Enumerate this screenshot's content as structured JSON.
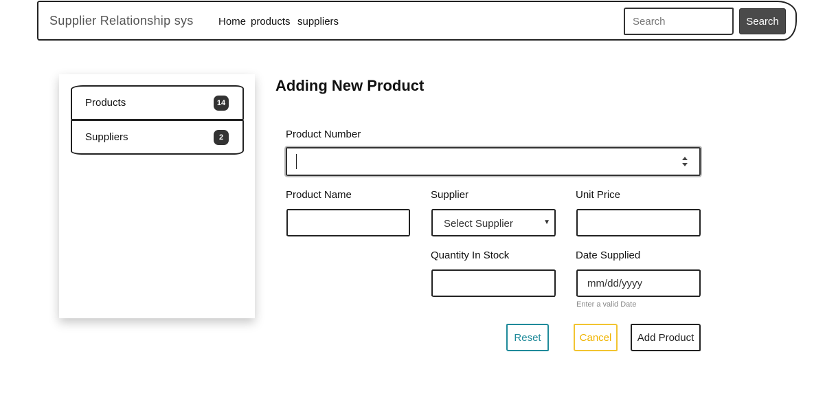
{
  "navbar": {
    "brand": "Supplier Relationship sys",
    "links": [
      "Home",
      "products",
      "suppliers"
    ],
    "search_placeholder": "Search",
    "search_button": "Search"
  },
  "sidebar": {
    "items": [
      {
        "label": "Products",
        "count": "14"
      },
      {
        "label": "Suppliers",
        "count": "2"
      }
    ]
  },
  "form": {
    "title": "Adding New Product",
    "product_number_label": "Product Number",
    "product_number_value": "",
    "product_name_label": "Product Name",
    "product_name_value": "",
    "supplier_label": "Supplier",
    "supplier_selected": "Select Supplier",
    "unit_price_label": "Unit Price",
    "unit_price_value": "",
    "quantity_label": "Quantity In Stock",
    "quantity_value": "",
    "date_label": "Date Supplied",
    "date_placeholder": "mm/dd/yyyy",
    "date_help": "Enter a valid Date",
    "buttons": {
      "reset": "Reset",
      "cancel": "Cancel",
      "add": "Add Product"
    }
  },
  "colors": {
    "reset": "#1f8a9a",
    "cancel": "#f0b400",
    "search_button_bg": "#4a4a4a"
  }
}
